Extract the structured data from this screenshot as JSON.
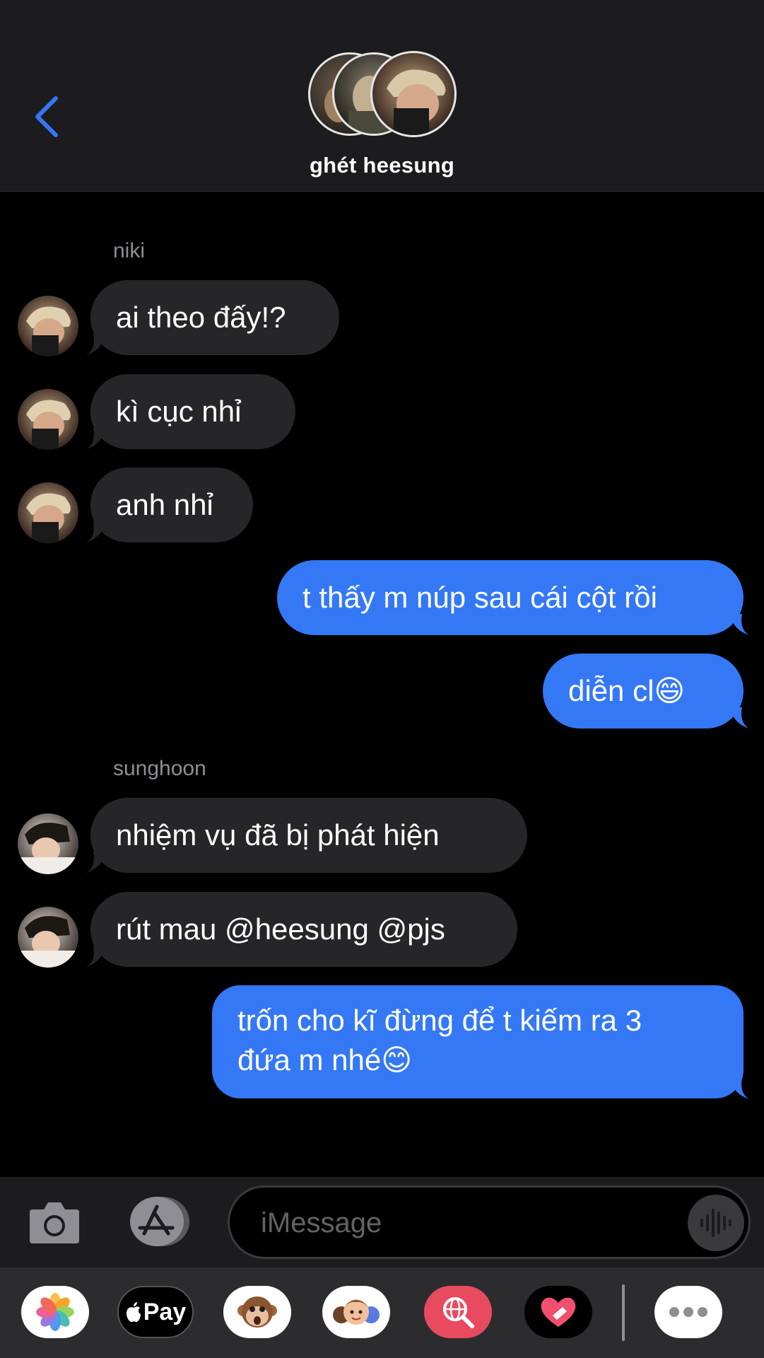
{
  "header": {
    "group_name": "ghét heesung"
  },
  "groups": [
    {
      "sender": "niki",
      "messages": [
        "ai theo đấy!?",
        "kì cục nhỉ",
        "anh nhỉ"
      ]
    },
    {
      "sender": "",
      "outgoing": [
        "t thấy m núp sau cái cột rồi",
        "diễn cl😄"
      ]
    },
    {
      "sender": "sunghoon",
      "messages": [
        "nhiệm vụ đã bị phát hiện",
        "rút mau @heesung @pjs"
      ]
    },
    {
      "sender": "",
      "outgoing_multi": [
        "trốn cho kĩ đừng để t kiếm ra 3",
        "đứa m nhé😊"
      ]
    }
  ],
  "input": {
    "placeholder": "iMessage"
  },
  "app_drawer": {
    "items": [
      "photos-icon",
      "apple-pay-icon",
      "animoji-icon",
      "memoji-icon",
      "web-search-icon",
      "digital-touch-icon",
      "more-icon"
    ],
    "apple_pay_label": "Pay"
  },
  "colors": {
    "accent": "#3478f6",
    "incoming_bubble": "#262628",
    "header_bg": "#1c1c1e"
  }
}
